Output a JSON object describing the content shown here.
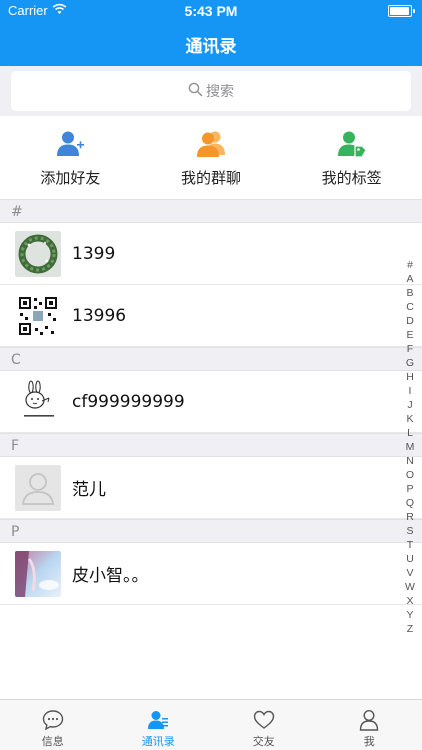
{
  "status_bar": {
    "carrier": "Carrier",
    "time": "5:43 PM",
    "battery_level": 0.95
  },
  "nav": {
    "title": "通讯录"
  },
  "search": {
    "placeholder": "搜索"
  },
  "quick_actions": [
    {
      "label": "添加好友",
      "icon": "add-friend-icon",
      "color": "#3f86d8"
    },
    {
      "label": "我的群聊",
      "icon": "group-chat-icon",
      "color": "#f5a03a"
    },
    {
      "label": "我的标签",
      "icon": "tag-icon",
      "color": "#36b35c"
    }
  ],
  "sections": [
    {
      "letter": "#",
      "contacts": [
        {
          "name": "1399",
          "avatar": "wreath-photo"
        },
        {
          "name": "13996",
          "avatar": "qr-code-image"
        }
      ]
    },
    {
      "letter": "C",
      "contacts": [
        {
          "name": "cf999999999",
          "avatar": "cartoon-sticker"
        }
      ]
    },
    {
      "letter": "F",
      "contacts": [
        {
          "name": "范儿",
          "avatar": "default-avatar"
        }
      ]
    },
    {
      "letter": "P",
      "contacts": [
        {
          "name": "皮小智。。",
          "avatar": "anime-photo"
        }
      ]
    }
  ],
  "index_letters": [
    "#",
    "A",
    "B",
    "C",
    "D",
    "E",
    "F",
    "G",
    "H",
    "I",
    "J",
    "K",
    "L",
    "M",
    "N",
    "O",
    "P",
    "Q",
    "R",
    "S",
    "T",
    "U",
    "V",
    "W",
    "X",
    "Y",
    "Z"
  ],
  "tabs": [
    {
      "label": "信息",
      "icon": "chat-bubble-icon",
      "active": false
    },
    {
      "label": "通讯录",
      "icon": "contacts-icon",
      "active": true
    },
    {
      "label": "交友",
      "icon": "heart-icon",
      "active": false
    },
    {
      "label": "我",
      "icon": "person-icon",
      "active": false
    }
  ],
  "colors": {
    "accent": "#1596f5",
    "background": "#efeff4"
  }
}
